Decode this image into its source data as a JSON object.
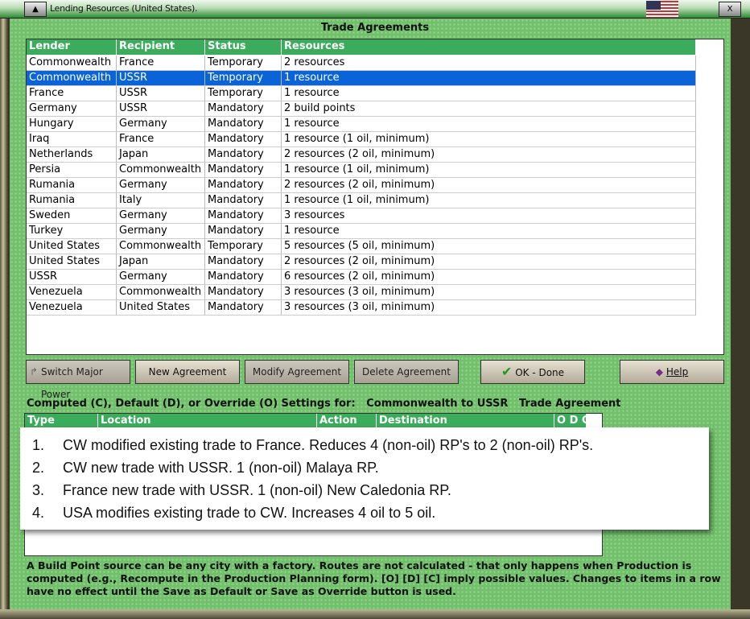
{
  "window": {
    "title": "Lending Resources (United States).",
    "close": "X",
    "min": "▲"
  },
  "heading": "Trade Agreements",
  "table": {
    "headers": [
      "Lender",
      "Recipient",
      "Status",
      "Resources"
    ],
    "rows": [
      [
        "Commonwealth",
        "France",
        "Temporary",
        "2 resources"
      ],
      [
        "Commonwealth",
        "USSR",
        "Temporary",
        "1 resource"
      ],
      [
        "France",
        "USSR",
        "Temporary",
        "1 resource"
      ],
      [
        "Germany",
        "USSR",
        "Mandatory",
        "2 build points"
      ],
      [
        "Hungary",
        "Germany",
        "Mandatory",
        "1 resource"
      ],
      [
        "Iraq",
        "France",
        "Mandatory",
        "1 resource (1 oil, minimum)"
      ],
      [
        "Netherlands",
        "Japan",
        "Mandatory",
        "2 resources (2 oil, minimum)"
      ],
      [
        "Persia",
        "Commonwealth",
        "Mandatory",
        "1 resource (1 oil, minimum)"
      ],
      [
        "Rumania",
        "Germany",
        "Mandatory",
        "2 resources (2 oil, minimum)"
      ],
      [
        "Rumania",
        "Italy",
        "Mandatory",
        "1 resource (1 oil, minimum)"
      ],
      [
        "Sweden",
        "Germany",
        "Mandatory",
        "3 resources"
      ],
      [
        "Turkey",
        "Germany",
        "Mandatory",
        "1 resource"
      ],
      [
        "United States",
        "Commonwealth",
        "Temporary",
        "5 resources (5 oil, minimum)"
      ],
      [
        "United States",
        "Japan",
        "Mandatory",
        "2 resources (2 oil, minimum)"
      ],
      [
        "USSR",
        "Germany",
        "Mandatory",
        "6 resources (2 oil, minimum)"
      ],
      [
        "Venezuela",
        "Commonwealth",
        "Mandatory",
        "3 resources (3 oil, minimum)"
      ],
      [
        "Venezuela",
        "United States",
        "Mandatory",
        "3 resources (3 oil, minimum)"
      ]
    ],
    "selected_index": 1
  },
  "buttons": {
    "switch": "Switch Major Power",
    "new": "New Agreement",
    "modify": "Modify Agreement",
    "delete": "Delete Agreement",
    "ok": "OK - Done",
    "help": "Help"
  },
  "settings": {
    "label": "Computed (C), Default (D), or Override (O) Settings for:",
    "subject": "Commonwealth to USSR",
    "suffix": "Trade Agreement",
    "headers": [
      "Type",
      "Location",
      "Action",
      "Destination",
      "O D C"
    ]
  },
  "notes": [
    {
      "n": "1.",
      "text": "CW modified existing trade to France.   Reduces 4 (non-oil) RP's to 2 (non-oil) RP's."
    },
    {
      "n": "2.",
      "text": "CW new trade with USSR.   1 (non-oil) Malaya RP."
    },
    {
      "n": "3.",
      "text": "France new trade with USSR.  1 (non-oil) New Caledonia RP."
    },
    {
      "n": "4.",
      "text": "USA modifies existing trade to CW.   Increases 4 oil to 5 oil."
    }
  ],
  "footer": "A Build Point source can be any city with a factory. Routes are not calculated - that only happens when Production is computed (e.g., Recompute in the Production Planning form).  [O] [D] [C] imply possible values.  Changes to items in a row have no effect until the Save as Default or Save as Override button is used."
}
